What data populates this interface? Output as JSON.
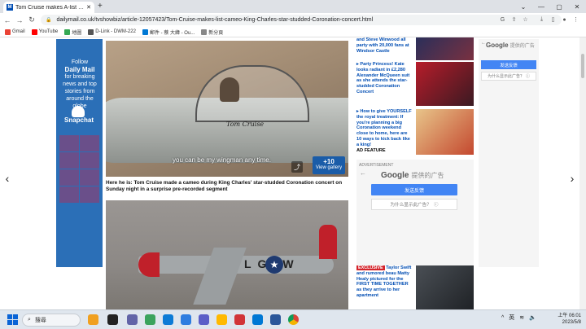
{
  "browser": {
    "tab_title": "Tom Cruise makes A-list cameo",
    "tab_favicon_letter": "M",
    "new_tab": "+",
    "url": "dailymail.co.uk/tvshowbiz/article-12057423/Tom-Cruise-makes-list-cameo-King-Charles-star-studded-Coronation-concert.html",
    "window_controls": [
      "⌄",
      "—",
      "▢",
      "✕"
    ],
    "nav": {
      "back": "←",
      "forward": "→",
      "reload": "↻"
    },
    "bookmarks": [
      {
        "label": "Gmail",
        "color": "#ea4335"
      },
      {
        "label": "YouTube",
        "color": "#ff0000"
      },
      {
        "label": "地圖",
        "color": "#34a853"
      },
      {
        "label": "D-Link - DWM-222",
        "color": "#555555"
      },
      {
        "label": "郵件 - 蔡 大緯 - Ou...",
        "color": "#0078d4"
      },
      {
        "label": "新分頁",
        "color": "#888888"
      }
    ]
  },
  "left_ad": {
    "line1": "Follow",
    "brand": "Daily Mail",
    "line2": "for breaking news and top stories from around the globe",
    "cta": "Snapchat"
  },
  "article": {
    "image1_caption_overlay": "you can be my wingman any time.",
    "plane_name": "Tom Cruise",
    "gallery_count": "+10",
    "gallery_label": "View gallery",
    "image1_caption": "Here he is: Tom Cruise made a cameo during King Charles' star-studded Coronation concert on Sunday night in a surprise pre-recorded segment",
    "plane2_code": "LG W"
  },
  "news": [
    {
      "title": "and Steve Winwood all party with 20,000 fans at Windsor Castle"
    },
    {
      "title": "Party Princess! Kate looks radiant in £2,280 Alexander McQueen suit as she attends the star-studded Coronation Concert"
    },
    {
      "title": "How to give YOURSELF the royal treatment: If you're planning a big Coronation weekend close to home, here are 10 ways to kick back like a king!",
      "tag": "AD FEATURE"
    },
    {
      "badge": "EXCLUSIVE",
      "title": "Taylor Swift and rumored beau Matty Healy pictured for the FIRST TIME TOGETHER as they arrive to her apartment"
    }
  ],
  "center_ad": {
    "label": "ADVERTISEMENT",
    "google": "Google",
    "provided": "提供的广告",
    "feedback": "发送反馈",
    "why": "为什么显示此广告？"
  },
  "right_ad": {
    "google": "Google",
    "provided": "提供的广告",
    "feedback": "发送反馈",
    "why": "为什么显示此广告？"
  },
  "taskbar": {
    "search_placeholder": "搜尋",
    "tray_lang": "英",
    "time": "上午 06:01",
    "date": "2023/5/8"
  }
}
